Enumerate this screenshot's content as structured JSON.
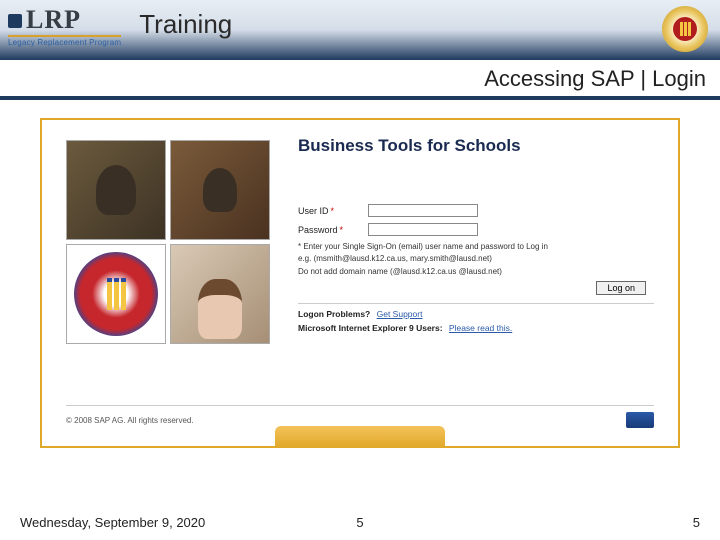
{
  "header": {
    "brand": "LRP",
    "brand_sub": "Legacy Replacement Program",
    "title": "Training"
  },
  "subheader": {
    "text": "Accessing SAP | Login"
  },
  "portal": {
    "title": "Business Tools for Schools",
    "form": {
      "user_id_label": "User ID",
      "user_id_value": "",
      "password_label": "Password",
      "password_value": "",
      "required_mark": "*",
      "hint_line1": "* Enter your Single Sign-On (email) user name and password to Log in",
      "hint_line2": "e.g. (msmith@lausd.k12.ca.us, mary.smith@lausd.net)",
      "hint_line3": "Do not add domain name (@lausd.k12.ca.us @lausd.net)",
      "logon_button": "Log on"
    },
    "help": {
      "problems_label": "Logon Problems?",
      "problems_link": "Get Support",
      "ie9_label": "Microsoft Internet Explorer 9 Users:",
      "ie9_link": "Please read this."
    },
    "footer": {
      "copyright": "© 2008 SAP AG. All rights reserved."
    }
  },
  "slide_footer": {
    "date": "Wednesday, September 9, 2020",
    "page_center": "5",
    "page_right": "5"
  }
}
